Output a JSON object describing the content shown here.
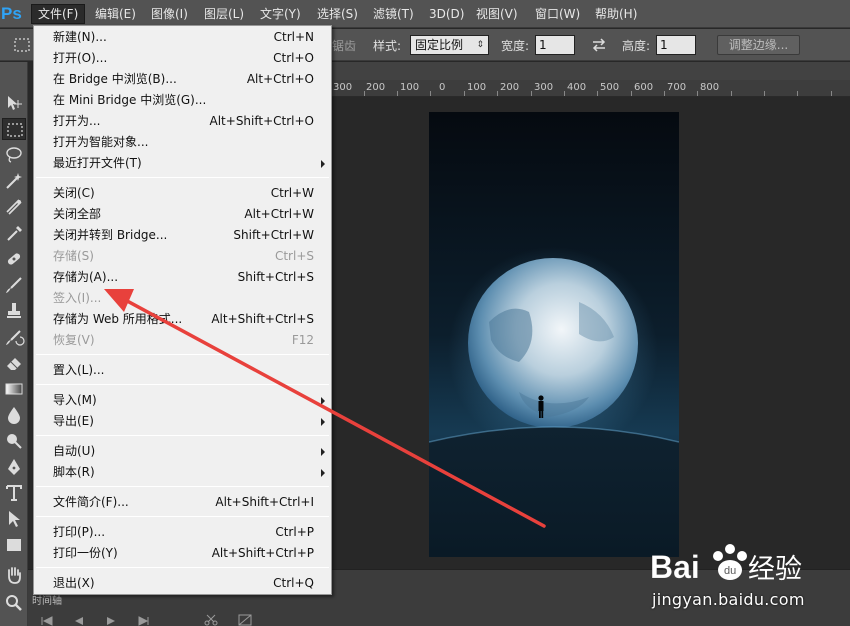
{
  "app": {
    "logo_text": "Ps",
    "accent": "#2fa3f6"
  },
  "menubar": {
    "items": [
      "文件(F)",
      "编辑(E)",
      "图像(I)",
      "图层(L)",
      "文字(Y)",
      "选择(S)",
      "滤镜(T)",
      "3D(D)",
      "视图(V)",
      "窗口(W)",
      "帮助(H)"
    ],
    "active": "文件(F)"
  },
  "options": {
    "partial_label": "锯齿",
    "style_label": "样式:",
    "style_value": "固定比例",
    "width_label": "宽度:",
    "width_value": "1",
    "height_label": "高度:",
    "height_value": "1",
    "refine_button": "调整边缘..."
  },
  "ruler": {
    "labels": [
      "300",
      "200",
      "100",
      "0",
      "100",
      "200",
      "300",
      "400",
      "500",
      "600",
      "700",
      "800"
    ]
  },
  "timeline": {
    "tab_label": "时间轴"
  },
  "file_menu": {
    "items": [
      {
        "label": "新建(N)...",
        "shortcut": "Ctrl+N",
        "disabled": false,
        "submenu": false
      },
      {
        "label": "打开(O)...",
        "shortcut": "Ctrl+O",
        "disabled": false,
        "submenu": false
      },
      {
        "label": "在 Bridge 中浏览(B)...",
        "shortcut": "Alt+Ctrl+O",
        "disabled": false,
        "submenu": false
      },
      {
        "label": "在 Mini Bridge 中浏览(G)...",
        "shortcut": "",
        "disabled": false,
        "submenu": false
      },
      {
        "label": "打开为...",
        "shortcut": "Alt+Shift+Ctrl+O",
        "disabled": false,
        "submenu": false
      },
      {
        "label": "打开为智能对象...",
        "shortcut": "",
        "disabled": false,
        "submenu": false
      },
      {
        "label": "最近打开文件(T)",
        "shortcut": "",
        "disabled": false,
        "submenu": true
      },
      {
        "label": "关闭(C)",
        "shortcut": "Ctrl+W",
        "disabled": false,
        "submenu": false
      },
      {
        "label": "关闭全部",
        "shortcut": "Alt+Ctrl+W",
        "disabled": false,
        "submenu": false
      },
      {
        "label": "关闭并转到 Bridge...",
        "shortcut": "Shift+Ctrl+W",
        "disabled": false,
        "submenu": false
      },
      {
        "label": "存储(S)",
        "shortcut": "Ctrl+S",
        "disabled": true,
        "submenu": false
      },
      {
        "label": "存储为(A)...",
        "shortcut": "Shift+Ctrl+S",
        "disabled": false,
        "submenu": false
      },
      {
        "label": "签入(I)...",
        "shortcut": "",
        "disabled": true,
        "submenu": false
      },
      {
        "label": "存储为 Web 所用格式...",
        "shortcut": "Alt+Shift+Ctrl+S",
        "disabled": false,
        "submenu": false
      },
      {
        "label": "恢复(V)",
        "shortcut": "F12",
        "disabled": true,
        "submenu": false
      },
      {
        "label": "置入(L)...",
        "shortcut": "",
        "disabled": false,
        "submenu": false
      },
      {
        "label": "导入(M)",
        "shortcut": "",
        "disabled": false,
        "submenu": true
      },
      {
        "label": "导出(E)",
        "shortcut": "",
        "disabled": false,
        "submenu": true
      },
      {
        "label": "自动(U)",
        "shortcut": "",
        "disabled": false,
        "submenu": true
      },
      {
        "label": "脚本(R)",
        "shortcut": "",
        "disabled": false,
        "submenu": true
      },
      {
        "label": "文件简介(F)...",
        "shortcut": "Alt+Shift+Ctrl+I",
        "disabled": false,
        "submenu": false
      },
      {
        "label": "打印(P)...",
        "shortcut": "Ctrl+P",
        "disabled": false,
        "submenu": false
      },
      {
        "label": "打印一份(Y)",
        "shortcut": "Alt+Shift+Ctrl+P",
        "disabled": false,
        "submenu": false
      },
      {
        "label": "退出(X)",
        "shortcut": "Ctrl+Q",
        "disabled": false,
        "submenu": false
      }
    ]
  },
  "annotation": {
    "arrow_color": "#e8413c"
  },
  "watermark": {
    "brand": "Bai",
    "brand_suffix": "经验",
    "url": "jingyan.baidu.com"
  }
}
